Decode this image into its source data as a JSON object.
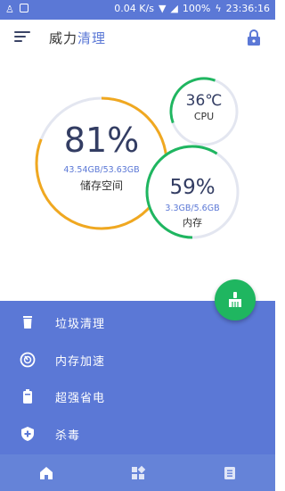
{
  "status_bar": {
    "speed": "0.04 K/s",
    "battery": "100%",
    "time": "23:36:16"
  },
  "app": {
    "title_part1": "威力",
    "title_part2": "清理"
  },
  "storage": {
    "percent": "81%",
    "detail": "43.54GB/53.63GB",
    "label": "储存空间",
    "value": 0.81
  },
  "cpu": {
    "temp": "36℃",
    "label": "CPU",
    "value": 0.36
  },
  "memory": {
    "percent": "59%",
    "detail": "3.3GB/5.6GB",
    "label": "内存",
    "value": 0.59
  },
  "menu": {
    "items": [
      {
        "label": "垃圾清理",
        "icon": "trash-icon"
      },
      {
        "label": "内存加速",
        "icon": "speedometer-icon"
      },
      {
        "label": "超强省电",
        "icon": "battery-icon"
      },
      {
        "label": "杀毒",
        "icon": "shield-plus-icon"
      }
    ]
  },
  "bottom_nav": {
    "tabs": [
      "home-icon",
      "apps-icon",
      "list-icon"
    ]
  },
  "colors": {
    "primary": "#5b78d6",
    "storage_ring": "#f0a820",
    "green": "#1fb660",
    "track": "#e3e6f0"
  }
}
